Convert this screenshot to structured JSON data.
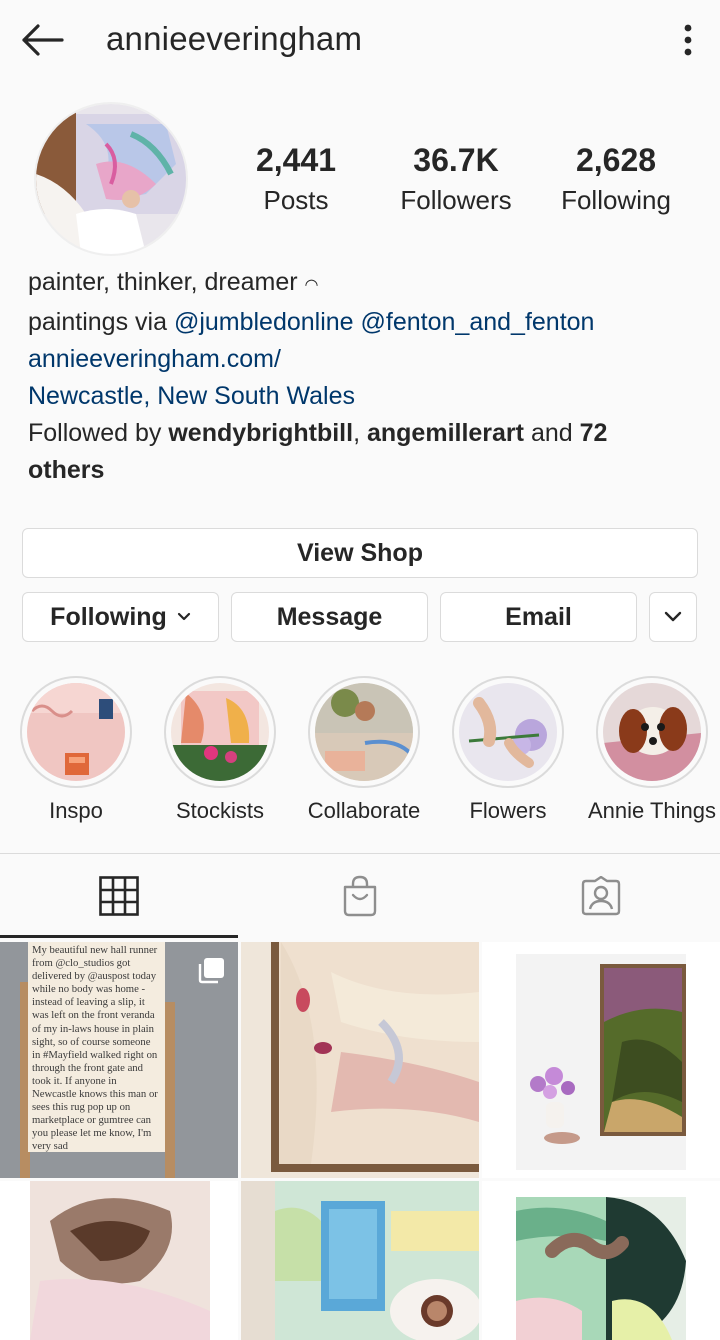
{
  "header": {
    "username": "annieeveringham"
  },
  "stats": [
    {
      "value": "2,441",
      "label": "Posts"
    },
    {
      "value": "36.7K",
      "label": "Followers"
    },
    {
      "value": "2,628",
      "label": "Following"
    }
  ],
  "bio": {
    "line1": "painter, thinker, dreamer",
    "line1_glyph": "◠",
    "line2_prefix": "paintings via ",
    "mention1": "@jumbledonline",
    "mention2": "@fenton_and_fenton",
    "website": "annieeveringham.com/",
    "location": "Newcastle, New South Wales",
    "followed_prefix": "Followed by ",
    "follower1": "wendybrightbill",
    "follower2": "angemillerart",
    "followed_and": " and ",
    "followed_count": "72",
    "followed_others": "others"
  },
  "buttons": {
    "view_shop": "View Shop",
    "following": "Following",
    "message": "Message",
    "email": "Email"
  },
  "highlights": [
    {
      "label": "Inspo"
    },
    {
      "label": "Stockists"
    },
    {
      "label": "Collaborate"
    },
    {
      "label": "Flowers"
    },
    {
      "label": "Annie Things"
    }
  ],
  "tabs": [
    {
      "icon": "grid-icon"
    },
    {
      "icon": "shopping-bag-icon"
    },
    {
      "icon": "tagged-user-icon"
    }
  ],
  "posts": [
    {
      "caption_text": "My beautiful new hall runner from @clo_studios got delivered by @auspost today while no body was home - instead of leaving a slip, it was left on the front veranda of my in-laws house in plain sight, so of course someone in #Mayfield walked right on through the front gate and took it. If anyone in Newcastle knows this man or sees this rug pop up on marketplace or gumtree can you please let me know, I'm very sad"
    }
  ],
  "colors": {
    "link": "#00376b",
    "text": "#262626",
    "border": "#dbdbdb",
    "background": "#fafafa"
  }
}
